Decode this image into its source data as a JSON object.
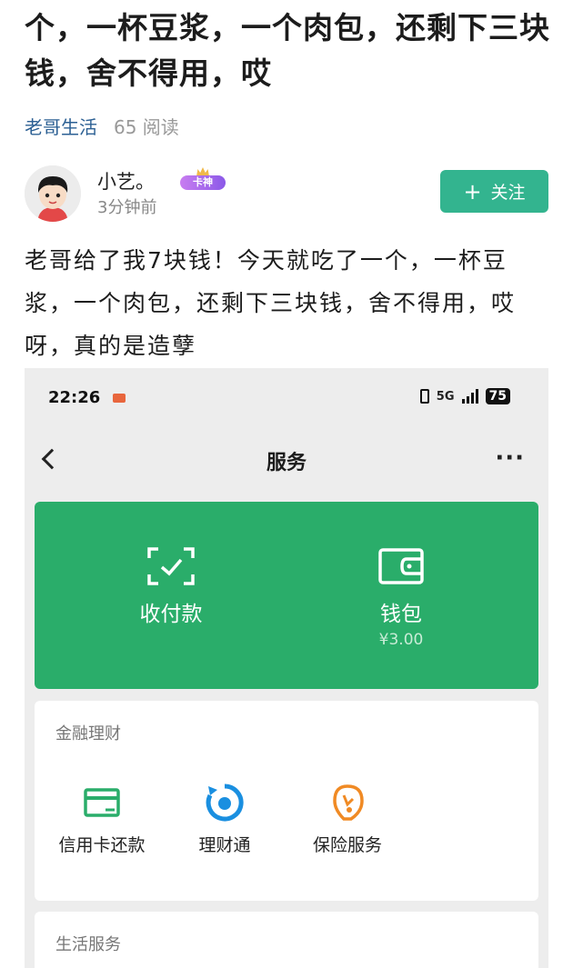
{
  "article": {
    "title": "个，一杯豆浆，一个肉包，还剩下三块钱，舍不得用，哎",
    "source": "老哥生活",
    "reads": "65 阅读",
    "author_name": "小艺。",
    "author_badge": "卡神",
    "author_time": "3分钟前",
    "follow_label": "关注",
    "body": "老哥给了我7块钱！今天就吃了一个，一杯豆浆，一个肉包，还剩下三块钱，舍不得用，哎呀，真的是造孽"
  },
  "screenshot": {
    "status_time": "22:26",
    "network": "5G",
    "battery": "75",
    "nav_title": "服务",
    "more_label": "···",
    "pay_label": "收付款",
    "wallet_label": "钱包",
    "wallet_balance": "¥3.00",
    "finance_title": "金融理财",
    "finance_items": [
      "信用卡还款",
      "理财通",
      "保险服务"
    ],
    "life_title": "生活服务"
  },
  "colors": {
    "follow": "#33b48f",
    "wechat_green": "#2aad6a",
    "source_link": "#2b5f93"
  },
  "icons": [
    "avatar-cartoon",
    "crown-badge",
    "plus-icon",
    "back-chevron-icon",
    "more-dots-icon",
    "scan-pay-icon",
    "wallet-icon",
    "credit-card-icon",
    "licaitong-icon",
    "insurance-icon"
  ]
}
